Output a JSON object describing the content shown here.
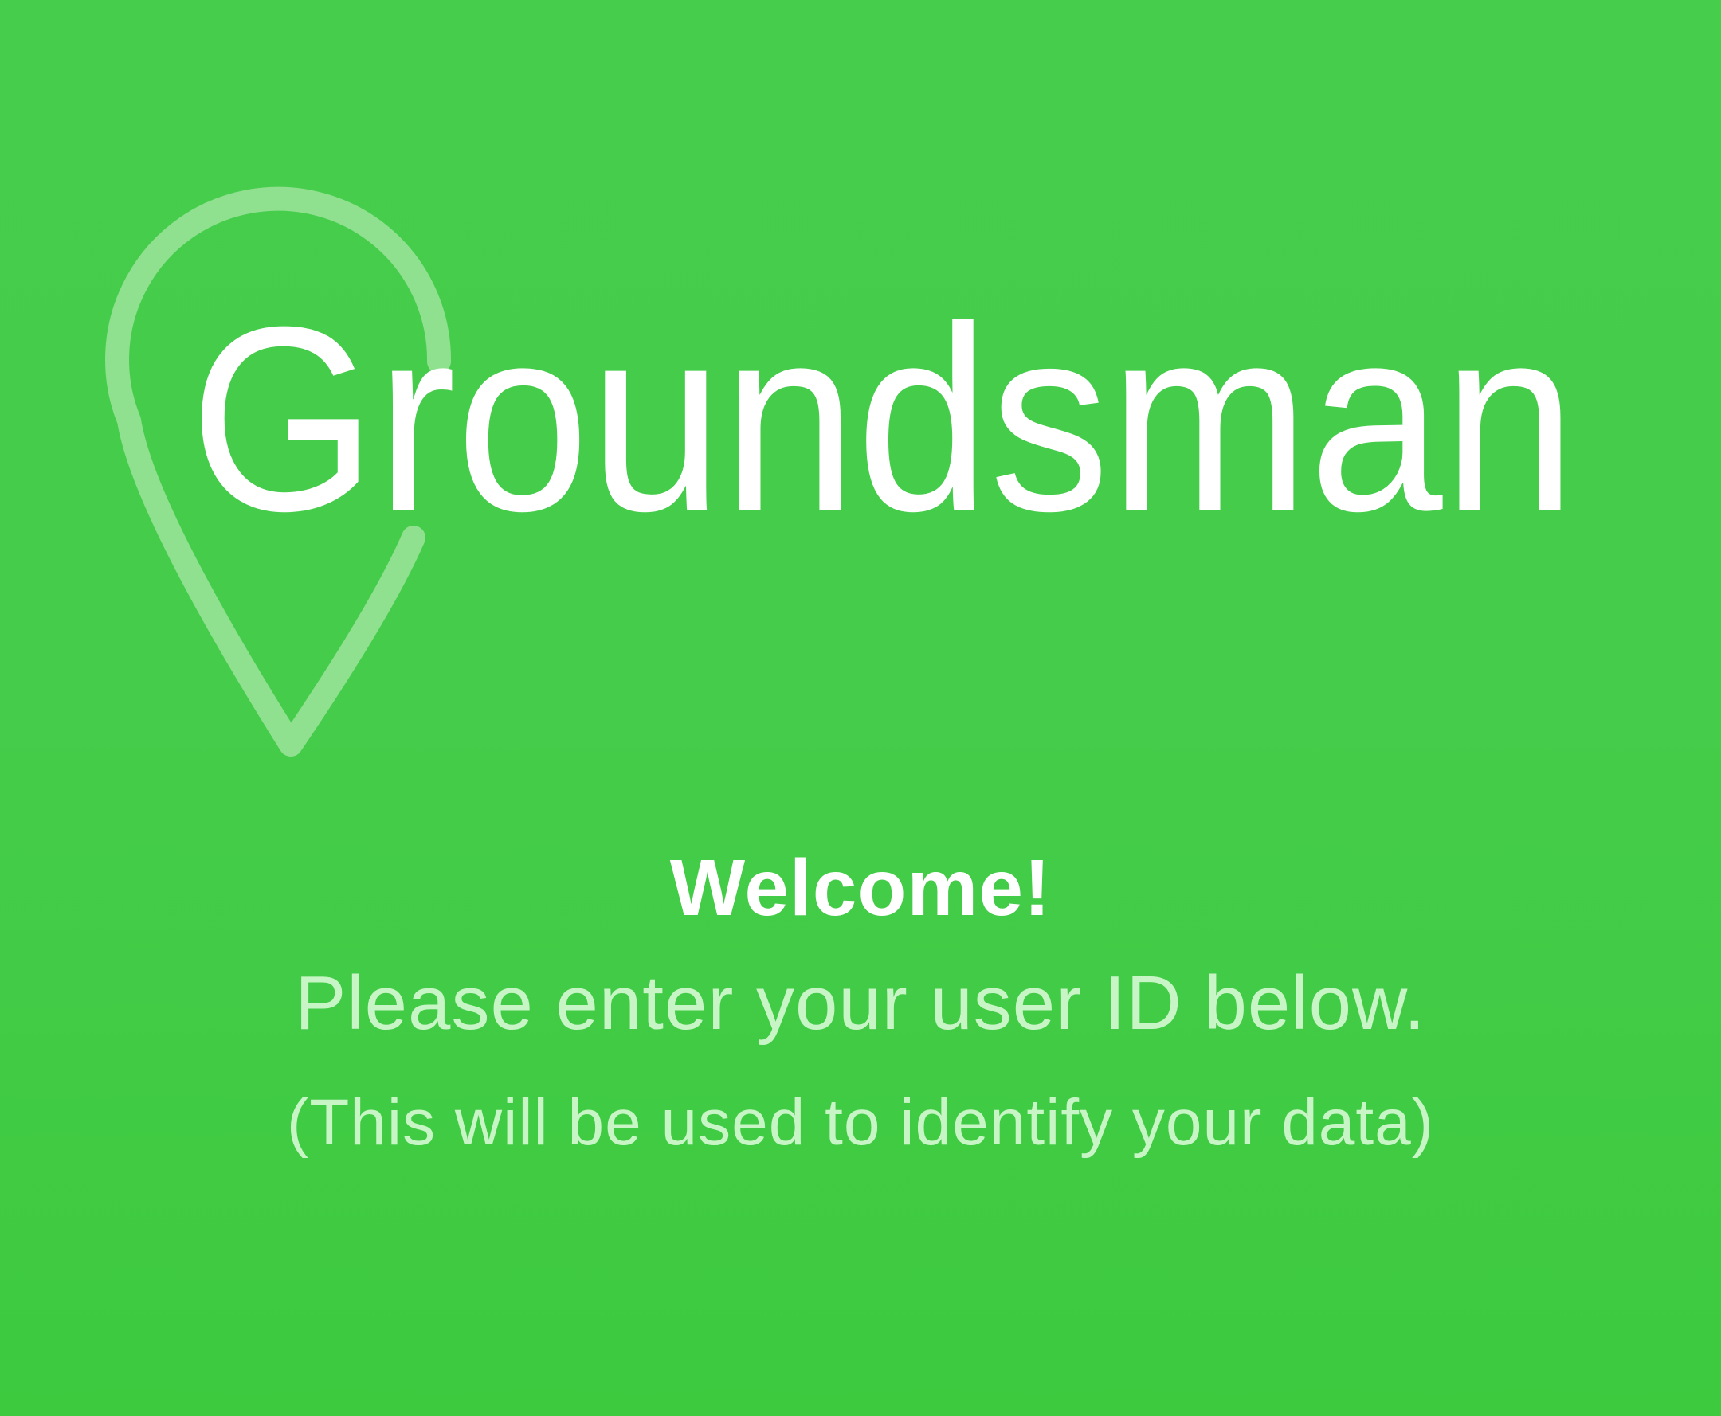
{
  "colors": {
    "background": "#45cc4a",
    "logo_text": "#ffffff",
    "pin_outline": "#8fe08f",
    "title": "#ffffff",
    "secondary_text": "#c8f5c6"
  },
  "logo": {
    "brand_name": "Groundsman",
    "pin_icon": "map-pin-icon"
  },
  "welcome": {
    "title": "Welcome!",
    "instruction": "Please enter your user ID below.",
    "note": "(This will be used to identify your data)"
  }
}
